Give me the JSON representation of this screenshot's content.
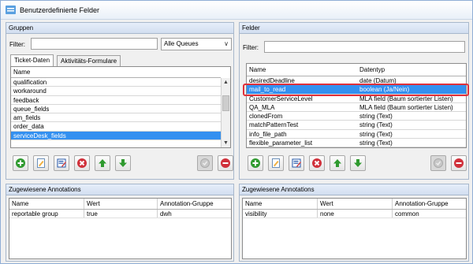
{
  "window": {
    "title": "Benutzerdefinierte Felder",
    "accent": "#3390f0",
    "highlight_color": "#e0303a"
  },
  "left": {
    "header": "Gruppen",
    "filter_label": "Filter:",
    "filter_value": "",
    "queue_select": "Alle Queues",
    "tabs": [
      "Ticket-Daten",
      "Aktivitäts-Formulare"
    ],
    "list_header": "Name",
    "rows": [
      "qualification",
      "workaround",
      "feedback",
      "queue_fields",
      "am_fields",
      "order_data",
      "serviceDesk_fields"
    ],
    "selected_index": 6
  },
  "right": {
    "header": "Felder",
    "filter_label": "Filter:",
    "filter_value": "",
    "columns": [
      "Name",
      "Datentyp"
    ],
    "rows": [
      [
        "desiredDeadline",
        "date (Datum)"
      ],
      [
        "mail_to_read",
        "boolean (Ja/Nein)"
      ],
      [
        "CustomerServiceLevel",
        "MLA field (Baum sortierter Listen)"
      ],
      [
        "QA_MLA",
        "MLA field (Baum sortierter Listen)"
      ],
      [
        "clonedFrom",
        "string (Text)"
      ],
      [
        "matchPatternTest",
        "string (Text)"
      ],
      [
        "info_file_path",
        "string (Text)"
      ],
      [
        "flexible_parameter_list",
        "string (Text)"
      ]
    ],
    "selected_index": 1
  },
  "toolbar_icons": [
    "add-icon",
    "edit-document-icon",
    "edit-list-icon",
    "delete-icon",
    "move-up-icon",
    "move-down-icon",
    "disabled-action-icon",
    "remove-icon"
  ],
  "annotations_left": {
    "header": "Zugewiesene Annotations",
    "columns": [
      "Name",
      "Wert",
      "Annotation-Gruppe"
    ],
    "rows": [
      [
        "reportable group",
        "true",
        "dwh"
      ]
    ]
  },
  "annotations_right": {
    "header": "Zugewiesene Annotations",
    "columns": [
      "Name",
      "Wert",
      "Annotation-Gruppe"
    ],
    "rows": [
      [
        "visibility",
        "none",
        "common"
      ]
    ]
  }
}
